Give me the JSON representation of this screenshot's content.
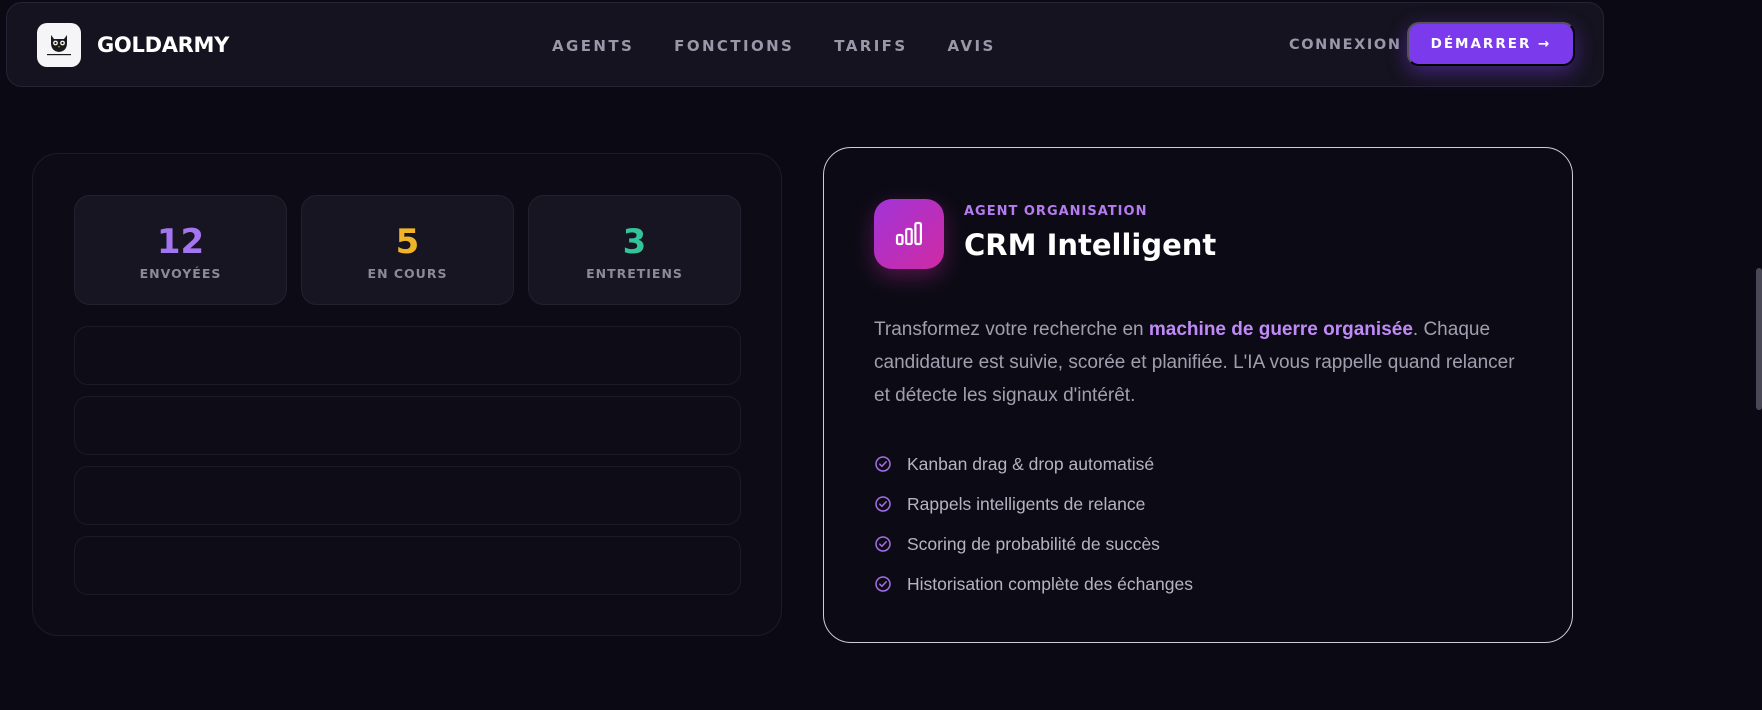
{
  "brand": {
    "name": "GOLDARMY",
    "logo_text": "GOLD ARMY"
  },
  "nav": {
    "links": [
      "AGENTS",
      "FONCTIONS",
      "TARIFS",
      "AVIS"
    ],
    "login": "CONNEXION",
    "start": "DÉMARRER →"
  },
  "stats": [
    {
      "value": "12",
      "label": "ENVOYÉES",
      "color": "#a475f0"
    },
    {
      "value": "5",
      "label": "EN COURS",
      "color": "#f0b429"
    },
    {
      "value": "3",
      "label": "ENTRETIENS",
      "color": "#34c49a"
    }
  ],
  "card": {
    "kicker": "AGENT ORGANISATION",
    "title": "CRM Intelligent",
    "desc_before": "Transformez votre recherche en ",
    "desc_highlight": "machine de guerre organisée",
    "desc_after": ". Chaque candidature est suivie, scorée et planifiée. L'IA vous rappelle quand relancer et détecte les signaux d'intérêt.",
    "features": [
      "Kanban drag & drop automatisé",
      "Rappels intelligents de relance",
      "Scoring de probabilité de succès",
      "Historisation complète des échanges"
    ]
  },
  "icons": {
    "logo": "owl-logo-icon",
    "card": "bar-chart-icon",
    "feature": "check-circle-icon"
  },
  "colors": {
    "accent": "#7c3aed",
    "highlight": "#c08af7",
    "background": "#0b0a14"
  }
}
